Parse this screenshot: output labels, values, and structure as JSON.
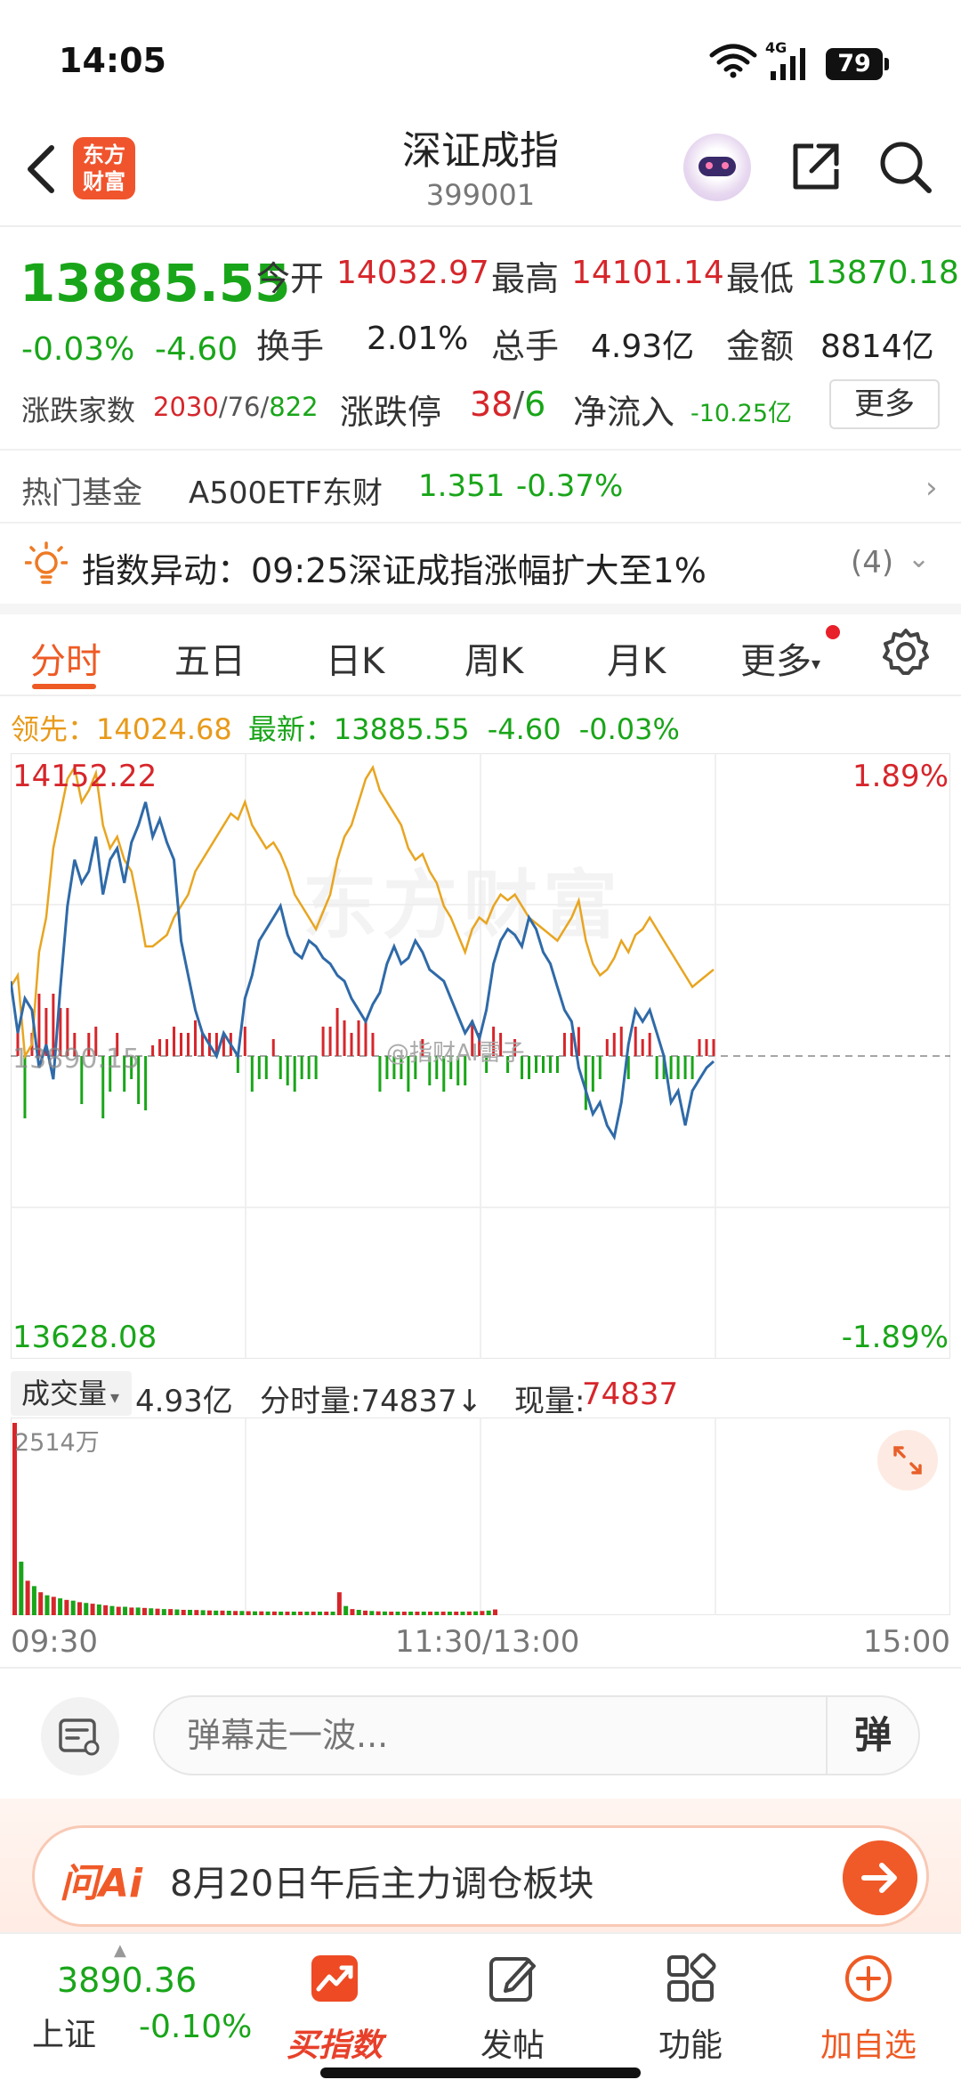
{
  "status_bar": {
    "time": "14:05",
    "network": "4G",
    "battery": "79"
  },
  "header": {
    "logo_text": "东方财富",
    "title": "深证成指",
    "code": "399001"
  },
  "quote": {
    "price": "13885.55",
    "change_pct": "-0.03%",
    "change_val": "-4.60",
    "open_label": "今开",
    "open": "14032.97",
    "high_label": "最高",
    "high": "14101.14",
    "low_label": "最低",
    "low": "13870.18",
    "turnover_label": "换手",
    "turnover": "2.01%",
    "volume_label": "总手",
    "volume": "4.93亿",
    "amount_label": "金额",
    "amount": "8814亿",
    "breadth_label": "涨跌家数",
    "breadth_up": "2030",
    "breadth_flat": "76",
    "breadth_down": "822",
    "limit_label": "涨跌停",
    "limit_up": "38",
    "limit_down": "6",
    "netflow_label": "净流入",
    "netflow": "-10.25亿",
    "more_label": "更多"
  },
  "fund": {
    "label": "热门基金",
    "name": "A500ETF东财",
    "price": "1.351",
    "pct": "-0.37%"
  },
  "alert": {
    "text": "指数异动：09:25深证成指涨幅扩大至1%",
    "count": "(4)"
  },
  "tabs": [
    "分时",
    "五日",
    "日K",
    "周K",
    "月K",
    "更多"
  ],
  "legend": {
    "lead_label": "领先：",
    "lead_value": "14024.68",
    "latest_label": "最新：",
    "latest_value": "13885.55",
    "latest_change": "-4.60",
    "latest_pct": "-0.03%"
  },
  "chart_axis": {
    "price_top": "14152.22",
    "pct_top": "1.89%",
    "price_mid": "13890.15",
    "price_bottom": "13628.08",
    "pct_bottom": "-1.89%",
    "watermark": "东方财富",
    "weibo_mark": "@指财AI雷子"
  },
  "volume": {
    "select_label": "成交量",
    "total": "4.93亿",
    "minute_label": "分时量:74837↓",
    "now_label": "现量:",
    "now_value": "74837",
    "max_label": "2514万"
  },
  "time_axis": {
    "start": "09:30",
    "mid": "11:30/13:00",
    "end": "15:00"
  },
  "comment": {
    "placeholder": "弹幕走一波...",
    "danmu_label": "弹"
  },
  "ai_banner": {
    "logo": "问Ai",
    "text": "8月20日午后主力调仓板块"
  },
  "bottom_nav": {
    "sh_price": "3890.36",
    "sh_name": "上证",
    "sh_pct": "-0.10%",
    "items": [
      {
        "label": "买指数"
      },
      {
        "label": "发帖"
      },
      {
        "label": "功能"
      },
      {
        "label": "加自选"
      }
    ]
  },
  "colors": {
    "up": "#d6262b",
    "down": "#19a519",
    "price_line": "#2f6aa8",
    "lead_line": "#e8a521",
    "accent": "#ee5a24"
  },
  "chart_data": [
    {
      "type": "line",
      "x_range": [
        "09:30",
        "15:00"
      ],
      "ylim": [
        13628.08,
        14152.22
      ],
      "reference": 13890.15,
      "series": [
        {
          "values": [
            13955,
            13910,
            13940,
            13930,
            13880,
            13900,
            13870,
            13950,
            14020,
            14060,
            14040,
            14050,
            14080,
            14030,
            14060,
            14070,
            14040,
            14075,
            14090,
            14110,
            14080,
            14095,
            14075,
            14060,
            13990,
            13960,
            13930,
            13910,
            13900,
            13890,
            13910,
            13900,
            13890,
            13940,
            13960,
            13990,
            14000,
            14010,
            14020,
            13995,
            13980,
            13975,
            13990,
            13985,
            13975,
            13970,
            13960,
            13955,
            13940,
            13930,
            13920,
            13935,
            13945,
            13970,
            13985,
            13970,
            13975,
            13990,
            13980,
            13965,
            13960,
            13955,
            13940,
            13925,
            13910,
            13920,
            13905,
            13930,
            13970,
            13990,
            14000,
            13995,
            13985,
            14010,
            14000,
            13980,
            13970,
            13950,
            13930,
            13920,
            13880,
            13860,
            13840,
            13850,
            13830,
            13820,
            13850,
            13900,
            13930,
            13920,
            13930,
            13910,
            13890,
            13850,
            13860,
            13830,
            13860,
            13870,
            13880,
            13885.55
          ]
        },
        {
          "values": [
            13950,
            13960,
            13890,
            13900,
            13980,
            14010,
            14070,
            14100,
            14130,
            14140,
            14110,
            14120,
            14135,
            14090,
            14070,
            14080,
            14060,
            14050,
            14020,
            13985,
            13985,
            13990,
            13995,
            14010,
            14020,
            14030,
            14050,
            14060,
            14070,
            14080,
            14090,
            14100,
            14095,
            14110,
            14090,
            14080,
            14070,
            14075,
            14065,
            14050,
            14030,
            14020,
            14010,
            14000,
            14015,
            14030,
            14060,
            14080,
            14090,
            14110,
            14130,
            14140,
            14120,
            14110,
            14100,
            14090,
            14070,
            14060,
            14065,
            14050,
            14040,
            14020,
            14010,
            13995,
            13980,
            14000,
            14010,
            14005,
            14020,
            14030,
            14025,
            14030,
            14020,
            14010,
            14005,
            14000,
            13995,
            13990,
            14000,
            14010,
            14024.68,
            13990,
            13970,
            13960,
            13965,
            13975,
            13990,
            13980,
            13995,
            14000,
            14010,
            14000,
            13990,
            13980,
            13970,
            13960,
            13950,
            13955,
            13960,
            13965
          ]
        }
      ]
    },
    {
      "type": "bar",
      "x_range": [
        "09:30",
        "15:00"
      ],
      "ylim": [
        0,
        2514
      ],
      "values": [
        2514,
        700,
        450,
        380,
        300,
        260,
        240,
        220,
        200,
        190,
        170,
        160,
        150,
        140,
        130,
        120,
        110,
        110,
        100,
        100,
        95,
        90,
        85,
        80,
        80,
        75,
        70,
        70,
        68,
        65,
        62,
        60,
        60,
        58,
        55,
        55,
        52,
        50,
        50,
        48,
        48,
        46,
        46,
        45,
        44,
        44,
        43,
        42,
        42,
        40,
        300,
        120,
        80,
        70,
        60,
        55,
        50,
        48,
        46,
        45,
        44,
        44,
        42,
        42,
        40,
        40,
        40,
        42,
        44,
        46,
        48,
        50,
        55,
        60,
        75
      ]
    }
  ]
}
